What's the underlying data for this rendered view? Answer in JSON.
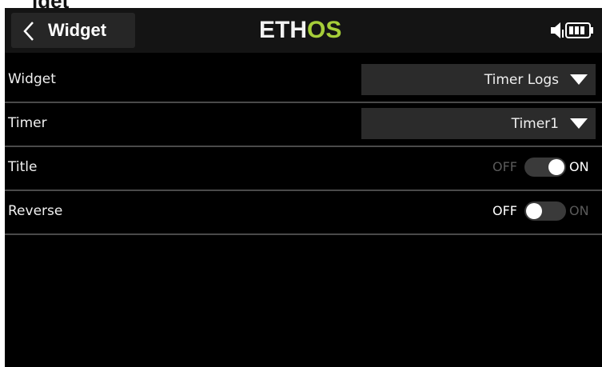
{
  "page_heading": "lget",
  "header": {
    "back_label": "Widget",
    "logo_left": "ETH",
    "logo_right": "OS",
    "logo_accent_color": "#a6ce39"
  },
  "rows": [
    {
      "label": "Widget",
      "type": "dropdown",
      "value": "Timer Logs"
    },
    {
      "label": "Timer",
      "type": "dropdown",
      "value": "Timer1"
    },
    {
      "label": "Title",
      "type": "toggle",
      "off_label": "OFF",
      "on_label": "ON",
      "state": "on"
    },
    {
      "label": "Reverse",
      "type": "toggle",
      "off_label": "OFF",
      "on_label": "ON",
      "state": "off"
    }
  ],
  "icons": {
    "back": "chevron-left-icon",
    "volume": "speaker-icon",
    "battery": "battery-icon",
    "dropdown": "caret-down-icon"
  }
}
